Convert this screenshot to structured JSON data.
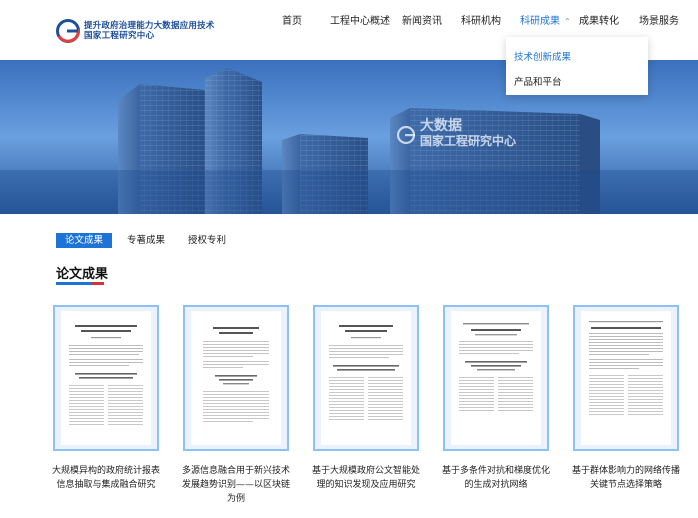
{
  "header": {
    "logo_line1": "提升政府治理能力大数据应用技术",
    "logo_line2": "国家工程研究中心"
  },
  "nav": {
    "items": [
      {
        "label": "首页"
      },
      {
        "label": "工程中心概述"
      },
      {
        "label": "新闻资讯"
      },
      {
        "label": "科研机构"
      },
      {
        "label": "科研成果"
      },
      {
        "label": "成果转化"
      },
      {
        "label": "场景服务"
      }
    ],
    "active_index": 4,
    "dropdown": [
      {
        "label": "技术创新成果"
      },
      {
        "label": "产品和平台"
      }
    ]
  },
  "banner": {
    "building_sign_line1": "大数据",
    "building_sign_line2": "国家工程研究中心"
  },
  "tabs": [
    {
      "label": "论文成果",
      "active": true
    },
    {
      "label": "专著成果",
      "active": false
    },
    {
      "label": "授权专利",
      "active": false
    }
  ],
  "section": {
    "title": "论文成果"
  },
  "papers": [
    {
      "title": "大规模异构的政府统计报表信息抽取与集成融合研究"
    },
    {
      "title": "多源信息融合用于新兴技术发展趋势识别——以区块链为例"
    },
    {
      "title": "基于大规模政府公文智能处理的知识发现及应用研究"
    },
    {
      "title": "基于多条件对抗和梯度优化的生成对抗网络"
    },
    {
      "title": "基于群体影响力的网络传播关键节点选择策略"
    }
  ],
  "colors": {
    "brand_blue": "#1e4f9c",
    "accent_blue": "#1e73d6",
    "accent_red": "#d3323b"
  }
}
